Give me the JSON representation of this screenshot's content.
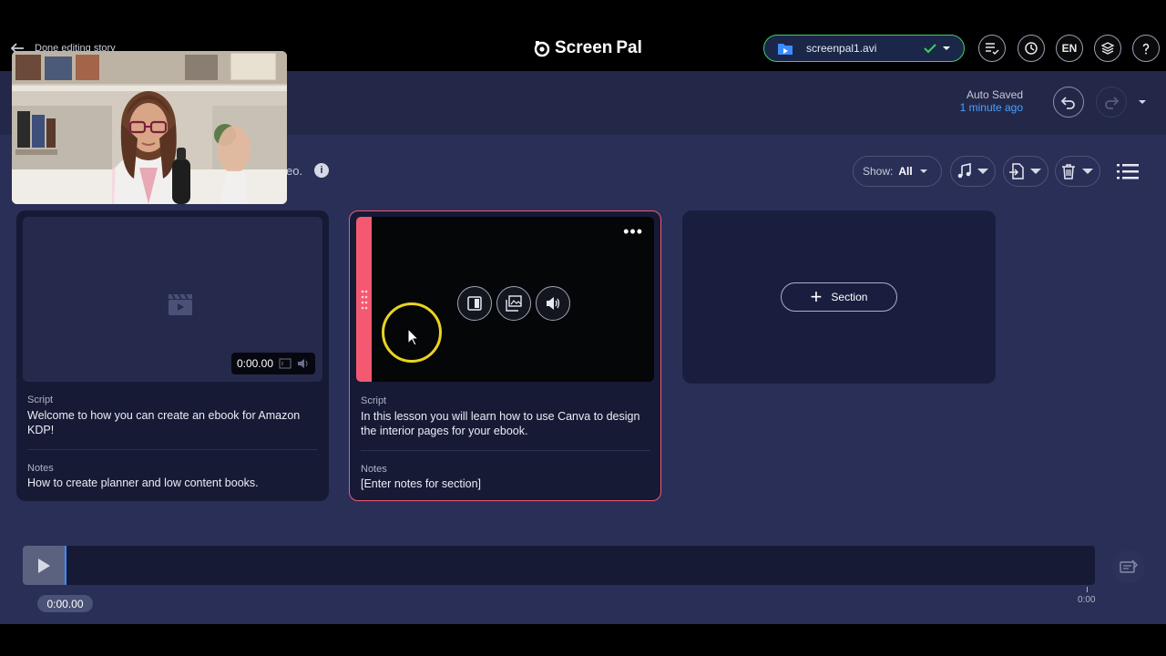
{
  "header": {
    "back_label": "Done editing story",
    "logo_screen": "Screen",
    "logo_pal": "Pal",
    "file_name": "screenpal1.avi",
    "lang": "EN"
  },
  "subheader": {
    "autosave_title": "Auto Saved",
    "autosave_time": "1 minute ago"
  },
  "toolbar": {
    "info_text": "eo.",
    "show_label": "Show:",
    "show_value": "All"
  },
  "sections": [
    {
      "timestamp": "0:00.00",
      "script_label": "Script",
      "script_text": "Welcome to how you can create an ebook for Amazon KDP!",
      "notes_label": "Notes",
      "notes_text": "How to create planner and low content books."
    },
    {
      "script_label": "Script",
      "script_text": "In this lesson you will learn how to use Canva to design the interior pages for your ebook.",
      "notes_label": "Notes",
      "notes_text": "[Enter notes for section]"
    }
  ],
  "add_section_label": "Section",
  "timeline": {
    "current_time": "0:00.00",
    "end_time": "0:00"
  },
  "colors": {
    "accent_pink": "#f35a72",
    "accent_green": "#3ecf6a",
    "accent_blue": "#4aa0ff",
    "cursor_ring": "#e8d420"
  }
}
